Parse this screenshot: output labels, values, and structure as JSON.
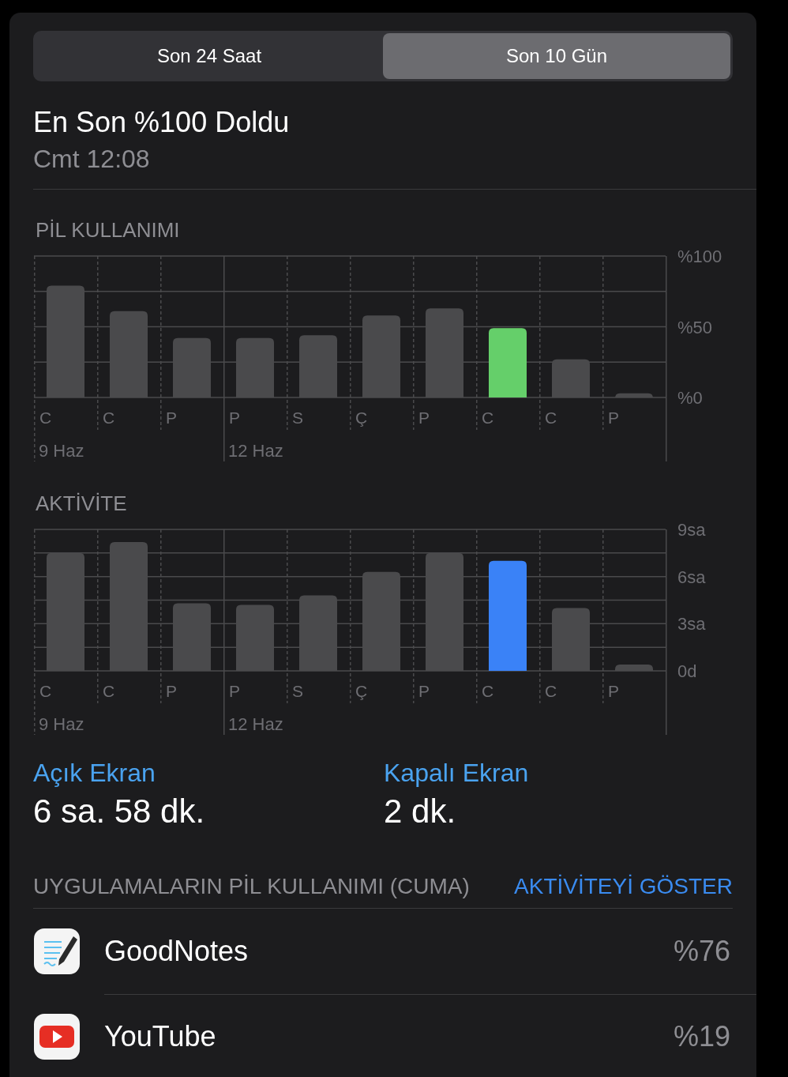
{
  "segmented_control": [
    {
      "label": "Son 24 Saat",
      "selected": false
    },
    {
      "label": "Son 10 Gün",
      "selected": true
    }
  ],
  "last_charge": {
    "title": "En Son %100 Doldu",
    "time": "Cmt 12:08"
  },
  "battery_usage": {
    "title": "PİL KULLANIMI",
    "date_labels": [
      "9 Haz",
      "12 Haz"
    ],
    "chart_data": {
      "type": "bar",
      "categories": [
        "C",
        "C",
        "P",
        "P",
        "S",
        "Ç",
        "P",
        "C",
        "C",
        "P"
      ],
      "series": [
        {
          "color": "#4a4a4c",
          "values": [
            79,
            61,
            42,
            42,
            44,
            58,
            63,
            null,
            27,
            3
          ]
        },
        {
          "color": "#65cf6a",
          "values": [
            null,
            null,
            null,
            null,
            null,
            null,
            null,
            49,
            null,
            null
          ]
        }
      ],
      "ylim": [
        0,
        100
      ],
      "yticks": [
        {
          "value": 0,
          "label": "%0"
        },
        {
          "value": 50,
          "label": "%50"
        },
        {
          "value": 100,
          "label": "%100"
        }
      ]
    }
  },
  "activity": {
    "title": "AKTİVİTE",
    "date_labels": [
      "9 Haz",
      "12 Haz"
    ],
    "chart_data": {
      "type": "bar",
      "categories": [
        "C",
        "C",
        "P",
        "P",
        "S",
        "Ç",
        "P",
        "C",
        "C",
        "P"
      ],
      "series": [
        {
          "color": "#4a4a4c",
          "values": [
            7.5,
            8.2,
            4.3,
            4.2,
            4.8,
            6.3,
            7.5,
            null,
            4.0,
            0.4
          ]
        },
        {
          "color": "#3a82f7",
          "values": [
            null,
            null,
            null,
            null,
            null,
            null,
            null,
            7.0,
            null,
            null
          ]
        }
      ],
      "ylim": [
        0,
        9
      ],
      "yticks": [
        {
          "value": 0,
          "label": "0d"
        },
        {
          "value": 3,
          "label": "3sa"
        },
        {
          "value": 6,
          "label": "6sa"
        },
        {
          "value": 9,
          "label": "9sa"
        }
      ]
    }
  },
  "screen_stats": [
    {
      "label": "Açık Ekran",
      "value": "6 sa. 58 dk."
    },
    {
      "label": "Kapalı Ekran",
      "value": "2 dk."
    }
  ],
  "apps_section": {
    "title": "UYGULAMALARIN PİL KULLANIMI (CUMA)",
    "action": "AKTİVİTEYİ GÖSTER"
  },
  "apps": [
    {
      "kind": "notes",
      "name": "GoodNotes",
      "percent": "%76"
    },
    {
      "kind": "video",
      "name": "YouTube",
      "percent": "%19"
    }
  ]
}
